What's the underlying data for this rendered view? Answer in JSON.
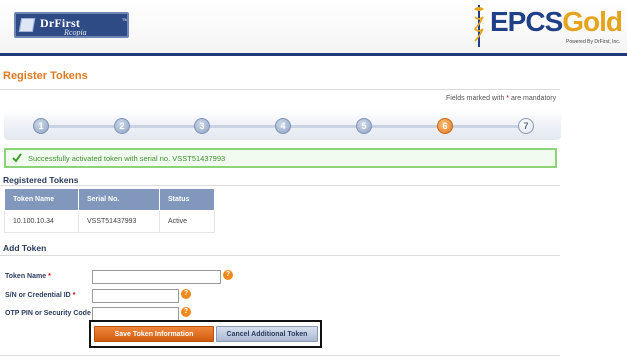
{
  "header": {
    "left_logo": {
      "brand": "DrFirst",
      "trademark": "TM",
      "sub": "Rcopia"
    },
    "right_logo": {
      "word_part1": "EPCS",
      "word_part2": "Gold",
      "powered_by": "Powered By DrFirst, Inc."
    }
  },
  "page": {
    "title": "Register Tokens",
    "mandatory_note_prefix": "Fields marked with ",
    "mandatory_star": "*",
    "mandatory_note_suffix": " are mandatory"
  },
  "stepper": {
    "steps": [
      "1",
      "2",
      "3",
      "4",
      "5",
      "6",
      "7"
    ],
    "current_step": 6
  },
  "success_message": "Successfully activated token with serial no. VSST51437993",
  "registered_tokens": {
    "heading": "Registered Tokens",
    "columns": [
      "Token Name",
      "Serial No.",
      "Status"
    ],
    "rows": [
      [
        "10.100.10.34",
        "VSST51437993",
        "Active"
      ]
    ]
  },
  "add_token": {
    "heading": "Add Token",
    "fields": [
      {
        "label": "Token Name",
        "required_mark": "*",
        "value": ""
      },
      {
        "label": "S/N or Credential ID",
        "required_mark": "*",
        "value": ""
      },
      {
        "label": "OTP PIN or Security Code",
        "required_mark": "*",
        "value": ""
      }
    ],
    "help_glyph": "?",
    "save_label": "Save Token Information",
    "cancel_label": "Cancel Additional Token"
  },
  "colors": {
    "accent_orange": "#e07a1f",
    "brand_blue": "#1f3a7a",
    "success_green": "#8cd37a"
  }
}
